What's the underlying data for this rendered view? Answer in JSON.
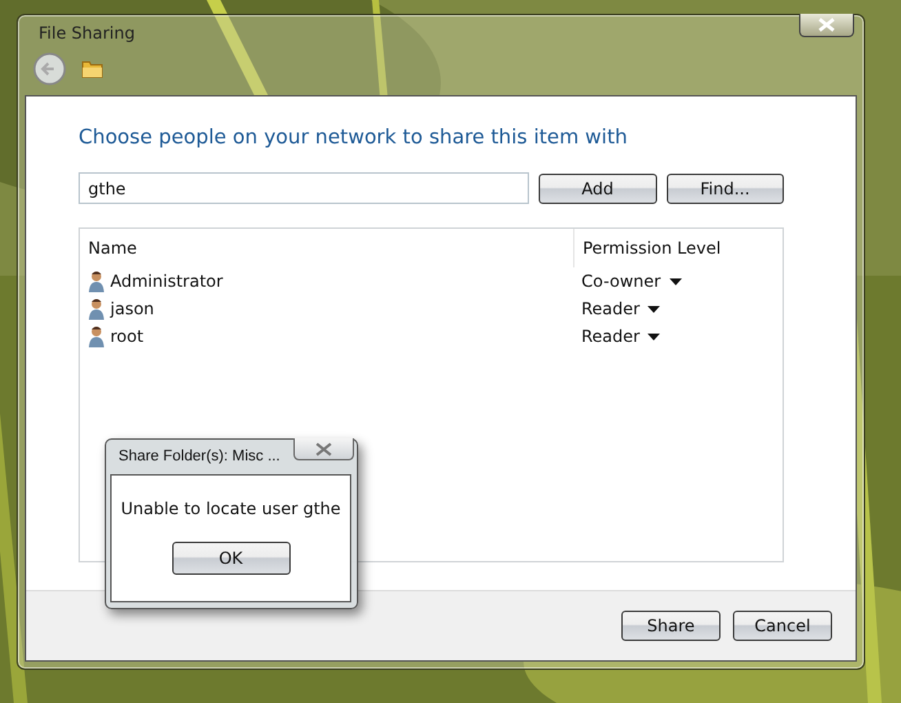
{
  "window": {
    "title": "File Sharing"
  },
  "heading": "Choose people on your network to share this item with",
  "name_field": {
    "value": "gthe"
  },
  "add_buttons": [
    "Add",
    "Find..."
  ],
  "table": {
    "columns": [
      "Name",
      "Permission Level"
    ],
    "rows": [
      {
        "name": "Administrator",
        "permission": "Co-owner"
      },
      {
        "name": "jason",
        "permission": "Reader"
      },
      {
        "name": "root",
        "permission": "Reader"
      }
    ]
  },
  "footer_buttons": [
    "Share",
    "Cancel"
  ],
  "message_box": {
    "title": "Share Folder(s): Misc ...",
    "message": "Unable to locate user gthe",
    "button": "OK"
  }
}
